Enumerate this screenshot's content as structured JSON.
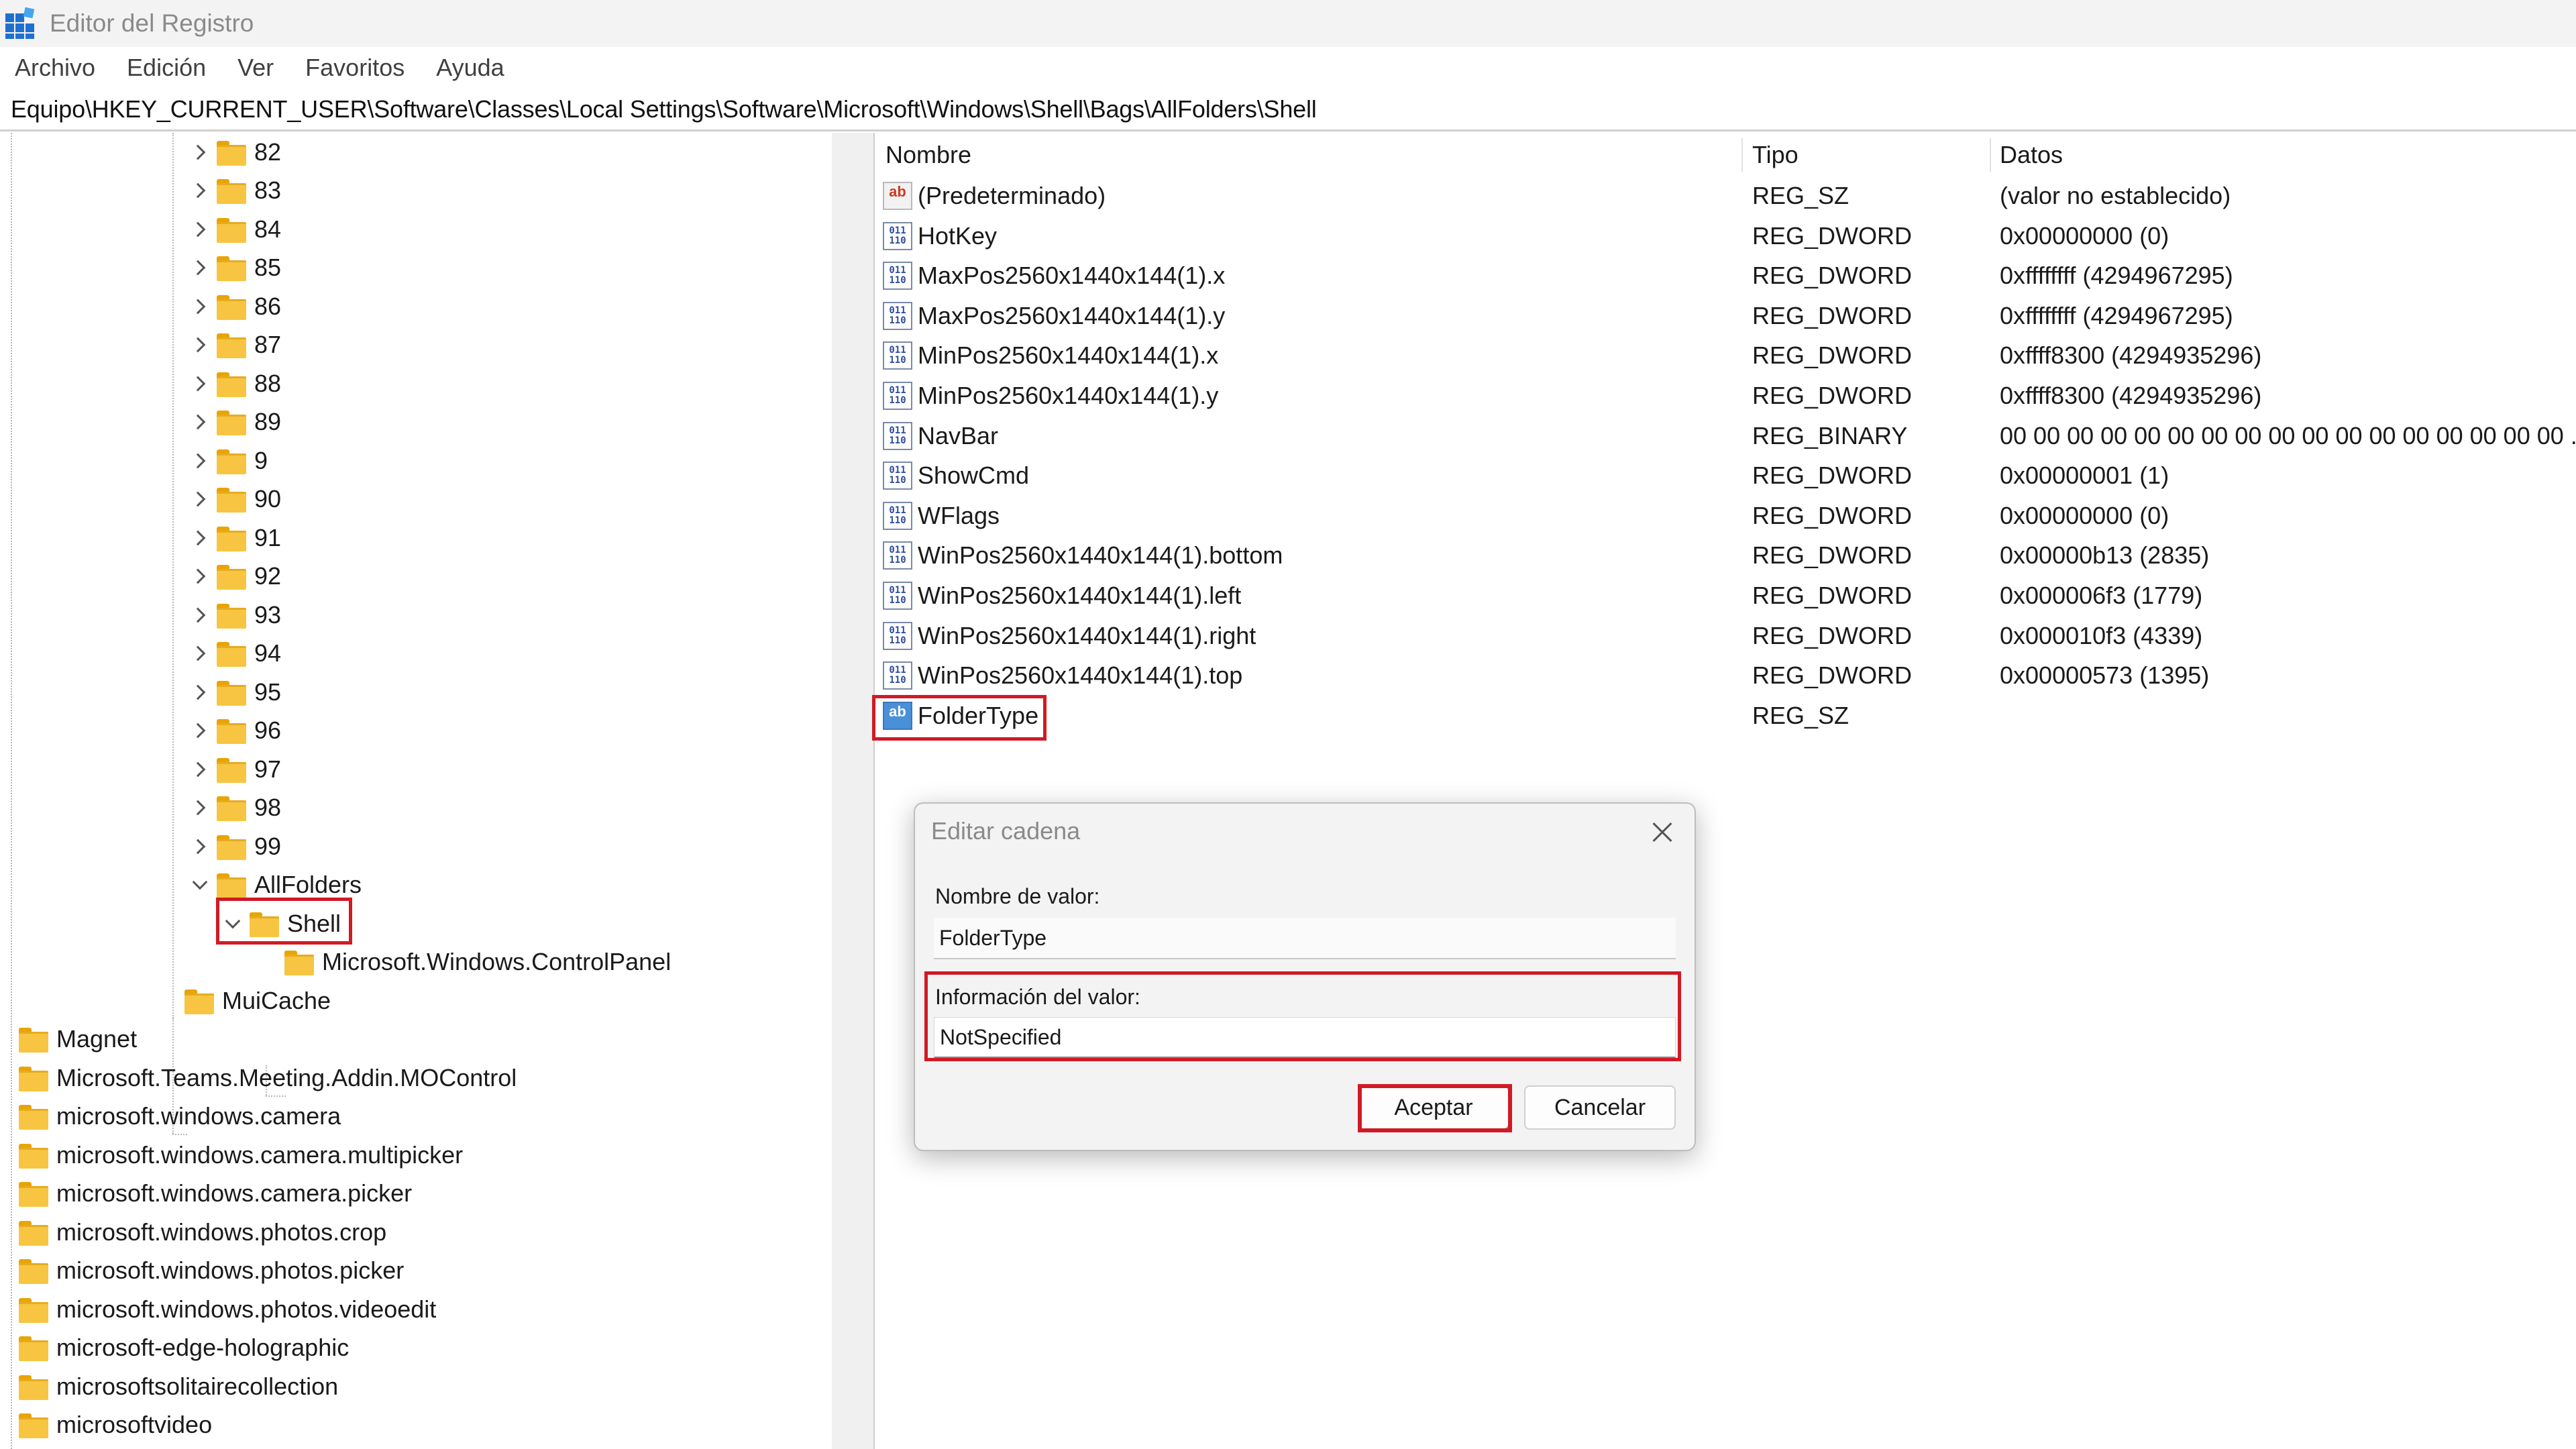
{
  "window": {
    "title": "Editor del Registro"
  },
  "menu": [
    "Archivo",
    "Edición",
    "Ver",
    "Favoritos",
    "Ayuda"
  ],
  "address": "Equipo\\HKEY_CURRENT_USER\\Software\\Classes\\Local Settings\\Software\\Microsoft\\Windows\\Shell\\Bags\\AllFolders\\Shell",
  "tree": {
    "numbered": [
      "82",
      "83",
      "84",
      "85",
      "86",
      "87",
      "88",
      "89",
      "9",
      "90",
      "91",
      "92",
      "93",
      "94",
      "95",
      "96",
      "97",
      "98",
      "99"
    ],
    "allfolders": "AllFolders",
    "shell": "Shell",
    "controlpanel": "Microsoft.Windows.ControlPanel",
    "muicache": "MuiCache",
    "roots": [
      "Magnet",
      "Microsoft.Teams.Meeting.Addin.MOControl",
      "microsoft.windows.camera",
      "microsoft.windows.camera.multipicker",
      "microsoft.windows.camera.picker",
      "microsoft.windows.photos.crop",
      "microsoft.windows.photos.picker",
      "microsoft.windows.photos.videoedit",
      "microsoft-edge-holographic",
      "microsoftsolitairecollection",
      "microsoftvideo"
    ]
  },
  "columns": {
    "name": "Nombre",
    "type": "Tipo",
    "data": "Datos"
  },
  "values": [
    {
      "name": "(Predeterminado)",
      "type": "REG_SZ",
      "data": "(valor no establecido)",
      "icon": "string-value-icon"
    },
    {
      "name": "HotKey",
      "type": "REG_DWORD",
      "data": "0x00000000 (0)",
      "icon": "binary-value-icon"
    },
    {
      "name": "MaxPos2560x1440x144(1).x",
      "type": "REG_DWORD",
      "data": "0xffffffff (4294967295)",
      "icon": "binary-value-icon"
    },
    {
      "name": "MaxPos2560x1440x144(1).y",
      "type": "REG_DWORD",
      "data": "0xffffffff (4294967295)",
      "icon": "binary-value-icon"
    },
    {
      "name": "MinPos2560x1440x144(1).x",
      "type": "REG_DWORD",
      "data": "0xffff8300 (4294935296)",
      "icon": "binary-value-icon"
    },
    {
      "name": "MinPos2560x1440x144(1).y",
      "type": "REG_DWORD",
      "data": "0xffff8300 (4294935296)",
      "icon": "binary-value-icon"
    },
    {
      "name": "NavBar",
      "type": "REG_BINARY",
      "data": "00 00 00 00 00 00 00 00 00 00 00 00 00 00 00 00 00 ...",
      "icon": "binary-value-icon"
    },
    {
      "name": "ShowCmd",
      "type": "REG_DWORD",
      "data": "0x00000001 (1)",
      "icon": "binary-value-icon"
    },
    {
      "name": "WFlags",
      "type": "REG_DWORD",
      "data": "0x00000000 (0)",
      "icon": "binary-value-icon"
    },
    {
      "name": "WinPos2560x1440x144(1).bottom",
      "type": "REG_DWORD",
      "data": "0x00000b13 (2835)",
      "icon": "binary-value-icon"
    },
    {
      "name": "WinPos2560x1440x144(1).left",
      "type": "REG_DWORD",
      "data": "0x000006f3 (1779)",
      "icon": "binary-value-icon"
    },
    {
      "name": "WinPos2560x1440x144(1).right",
      "type": "REG_DWORD",
      "data": "0x000010f3 (4339)",
      "icon": "binary-value-icon"
    },
    {
      "name": "WinPos2560x1440x144(1).top",
      "type": "REG_DWORD",
      "data": "0x00000573 (1395)",
      "icon": "binary-value-icon"
    },
    {
      "name": "FolderType",
      "type": "REG_SZ",
      "data": "",
      "icon": "string-value-icon"
    }
  ],
  "dialog": {
    "title": "Editar cadena",
    "name_label": "Nombre de valor:",
    "name_value": "FolderType",
    "data_label": "Información del valor:",
    "data_value": "NotSpecified",
    "ok": "Aceptar",
    "cancel": "Cancelar"
  },
  "colors": {
    "highlight": "#d11a24",
    "folder": "#f7c541"
  }
}
